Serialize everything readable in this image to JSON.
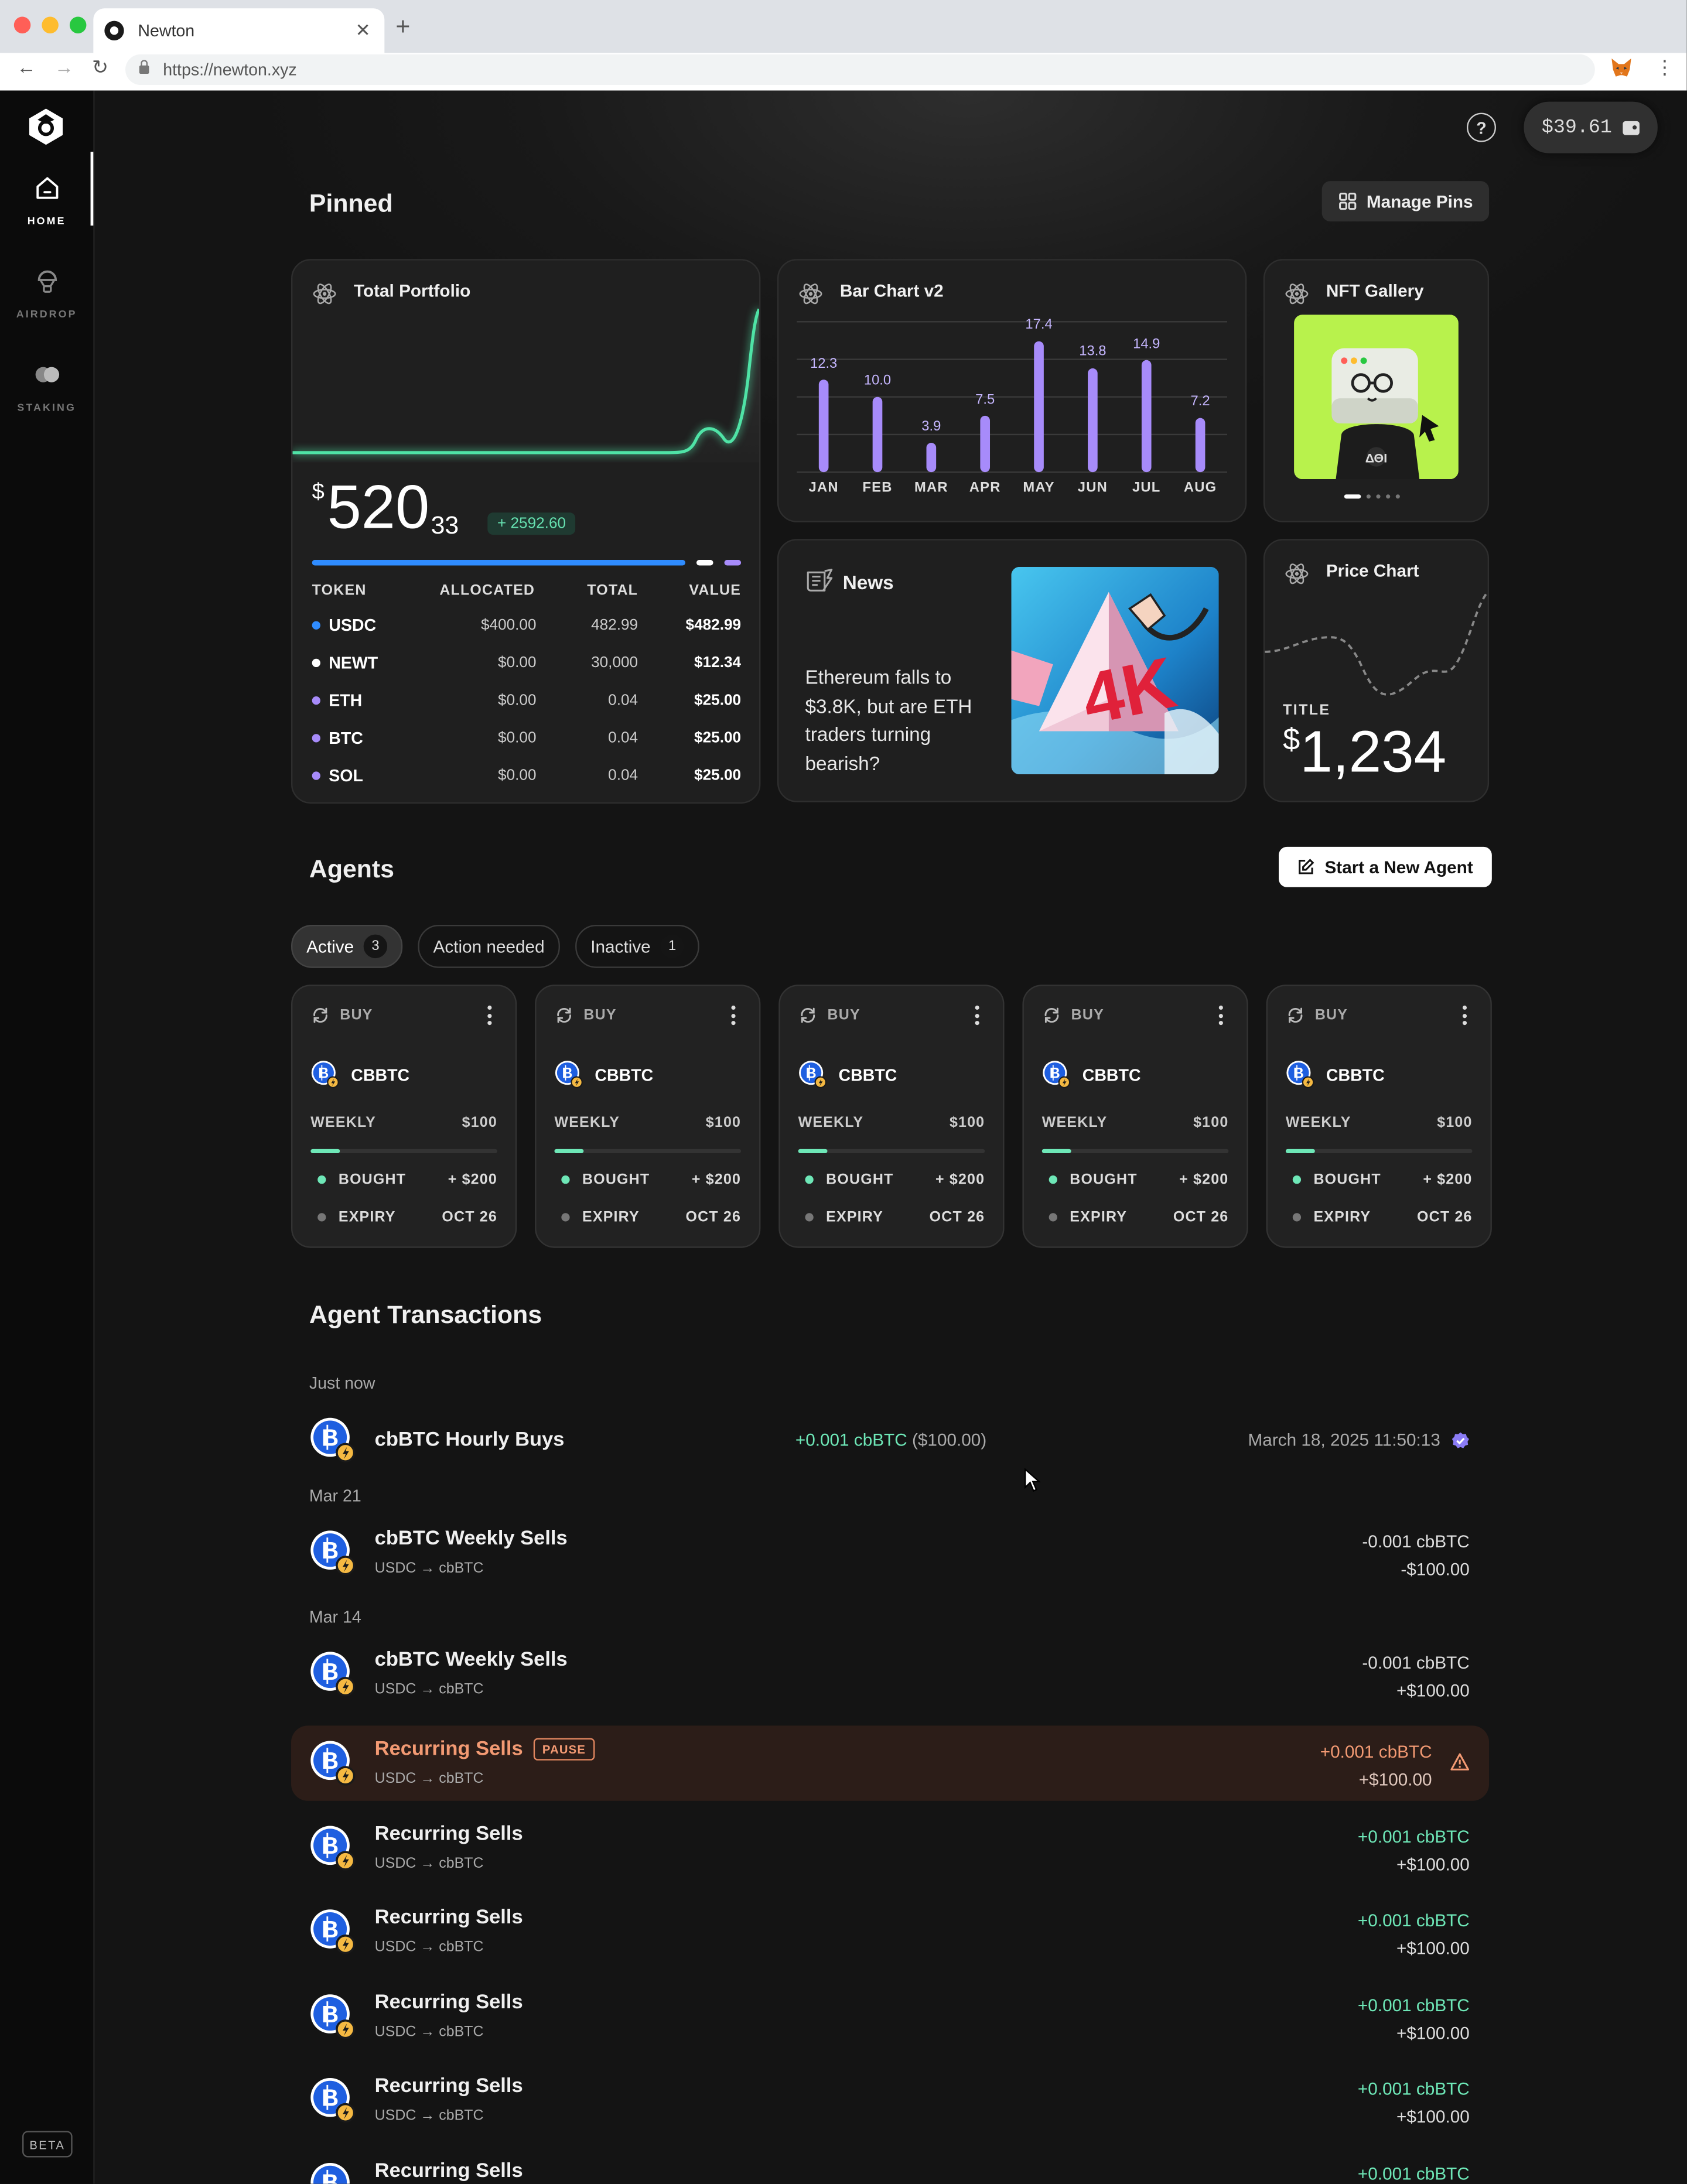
{
  "browser": {
    "tab_title": "Newton",
    "url": "https://newton.xyz"
  },
  "sidebar": {
    "items": [
      {
        "label": "HOME",
        "icon": "home-icon"
      },
      {
        "label": "AIRDROP",
        "icon": "airdrop-icon"
      },
      {
        "label": "STAKING",
        "icon": "staking-icon"
      }
    ],
    "beta": "BETA"
  },
  "header": {
    "wallet_balance": "$39.61"
  },
  "pinned": {
    "title": "Pinned",
    "manage_label": "Manage Pins",
    "portfolio": {
      "title": "Total Portfolio",
      "currency": "$",
      "value_int": "520",
      "value_dec": "33",
      "change": "+ 2592.60",
      "columns": [
        "TOKEN",
        "ALLOCATED",
        "TOTAL",
        "VALUE"
      ],
      "rows": [
        {
          "token": "USDC",
          "allocated": "$400.00",
          "total": "482.99",
          "value": "$482.99",
          "color": "#2f8cff"
        },
        {
          "token": "NEWT",
          "allocated": "$0.00",
          "total": "30,000",
          "value": "$12.34",
          "color": "#ffffff"
        },
        {
          "token": "ETH",
          "allocated": "$0.00",
          "total": "0.04",
          "value": "$25.00",
          "color": "#a78bfa"
        },
        {
          "token": "BTC",
          "allocated": "$0.00",
          "total": "0.04",
          "value": "$25.00",
          "color": "#a78bfa"
        },
        {
          "token": "SOL",
          "allocated": "$0.00",
          "total": "0.04",
          "value": "$25.00",
          "color": "#a78bfa"
        }
      ]
    },
    "bar_chart": {
      "title": "Bar Chart v2"
    },
    "nft": {
      "title": "NFT Gallery"
    },
    "news": {
      "title": "News",
      "headline": "Ethereum falls to $3.8K, but are ETH traders turning bearish?"
    },
    "price_chart": {
      "title": "Price Chart",
      "label": "TITLE",
      "currency": "$",
      "value": "1,234"
    }
  },
  "chart_data": {
    "type": "bar",
    "categories": [
      "JAN",
      "FEB",
      "MAR",
      "APR",
      "MAY",
      "JUN",
      "JUL",
      "AUG"
    ],
    "values": [
      12.3,
      10.0,
      3.9,
      7.5,
      17.4,
      13.8,
      14.9,
      7.2
    ],
    "labels": [
      "12.3",
      "10.0",
      "3.9",
      "7.5",
      "17.4",
      "13.8",
      "14.9",
      "7.2"
    ],
    "title": "Bar Chart v2",
    "ylim": [
      0,
      20
    ],
    "grid": true
  },
  "agents": {
    "title": "Agents",
    "new_agent_label": "Start a New Agent",
    "filters": [
      {
        "label": "Active",
        "count": "3"
      },
      {
        "label": "Action needed",
        "count": ""
      },
      {
        "label": "Inactive",
        "count": "1"
      }
    ],
    "cards": [
      {
        "type": "BUY",
        "token": "CBBTC",
        "freq": "WEEKLY",
        "amount": "$100",
        "progress": 0.16,
        "bought_label": "BOUGHT",
        "bought": "+ $200",
        "expiry_label": "EXPIRY",
        "expiry": "OCT 26"
      },
      {
        "type": "BUY",
        "token": "CBBTC",
        "freq": "WEEKLY",
        "amount": "$100",
        "progress": 0.16,
        "bought_label": "BOUGHT",
        "bought": "+ $200",
        "expiry_label": "EXPIRY",
        "expiry": "OCT 26"
      },
      {
        "type": "BUY",
        "token": "CBBTC",
        "freq": "WEEKLY",
        "amount": "$100",
        "progress": 0.16,
        "bought_label": "BOUGHT",
        "bought": "+ $200",
        "expiry_label": "EXPIRY",
        "expiry": "OCT 26"
      },
      {
        "type": "BUY",
        "token": "CBBTC",
        "freq": "WEEKLY",
        "amount": "$100",
        "progress": 0.16,
        "bought_label": "BOUGHT",
        "bought": "+ $200",
        "expiry_label": "EXPIRY",
        "expiry": "OCT 26"
      },
      {
        "type": "BUY",
        "token": "CBBTC",
        "freq": "WEEKLY",
        "amount": "$100",
        "progress": 0.16,
        "bought_label": "BOUGHT",
        "bought": "+ $200",
        "expiry_label": "EXPIRY",
        "expiry": "OCT 26"
      }
    ]
  },
  "transactions": {
    "title": "Agent Transactions",
    "groups": [
      "Just now",
      "Mar 21",
      "Mar 14"
    ],
    "latest": {
      "name": "cbBTC Hourly Buys",
      "amount_pos": "+0.001 cbBTC",
      "amount_usd": "($100.00)",
      "timestamp": "March 18, 2025 11:50:13"
    },
    "items": [
      {
        "name": "cbBTC Weekly Sells",
        "sub": "USDC → cbBTC",
        "amt1": "-0.001 cbBTC",
        "amt2": "-$100.00",
        "kind": "neutral"
      },
      {
        "name": "cbBTC Weekly Sells",
        "sub": "USDC → cbBTC",
        "amt1": "-0.001 cbBTC",
        "amt2": "+$100.00",
        "kind": "neutral"
      },
      {
        "name": "Recurring Sells",
        "sub": "USDC → cbBTC",
        "amt1": "+0.001 cbBTC",
        "amt2": "+$100.00",
        "kind": "alert",
        "badge": "PAUSE"
      },
      {
        "name": "Recurring Sells",
        "sub": "USDC → cbBTC",
        "amt1": "+0.001 cbBTC",
        "amt2": "+$100.00",
        "kind": "pos"
      },
      {
        "name": "Recurring Sells",
        "sub": "USDC → cbBTC",
        "amt1": "+0.001 cbBTC",
        "amt2": "+$100.00",
        "kind": "pos"
      },
      {
        "name": "Recurring Sells",
        "sub": "USDC → cbBTC",
        "amt1": "+0.001 cbBTC",
        "amt2": "+$100.00",
        "kind": "pos"
      },
      {
        "name": "Recurring Sells",
        "sub": "USDC → cbBTC",
        "amt1": "+0.001 cbBTC",
        "amt2": "+$100.00",
        "kind": "pos"
      },
      {
        "name": "Recurring Sells",
        "sub": "",
        "amt1": "+0.001 cbBTC",
        "amt2": "",
        "kind": "pos"
      }
    ]
  },
  "colors": {
    "accent_green": "#6ee7b7",
    "accent_purple": "#a78bfa",
    "alert_orange": "#f39a73",
    "background": "#141414"
  }
}
